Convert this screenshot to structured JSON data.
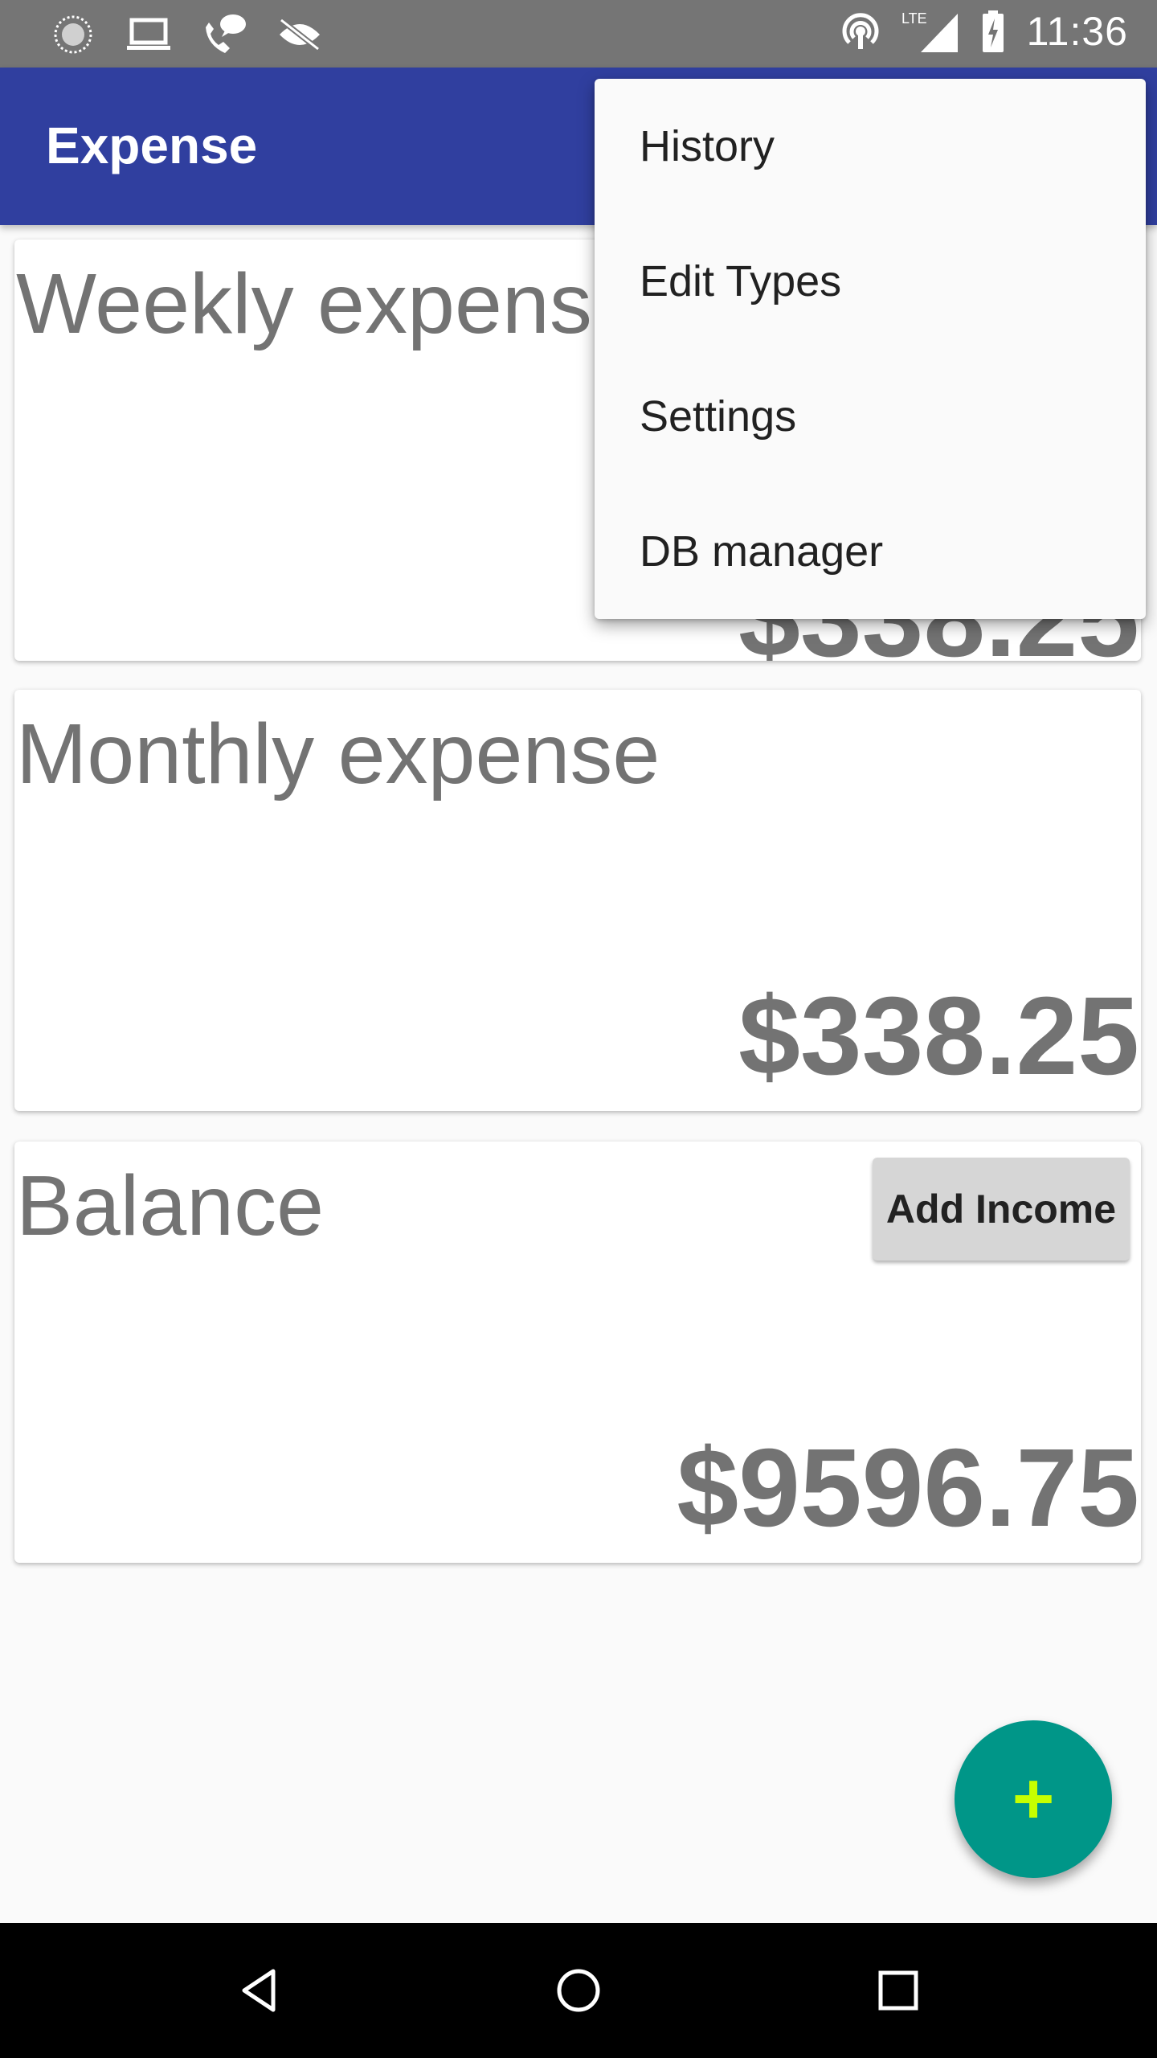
{
  "status_bar": {
    "time": "11:36",
    "network": "LTE",
    "left_icons": [
      "sync-icon",
      "laptop-icon",
      "phone-chat-icon",
      "eye-off-icon"
    ],
    "right_icons": [
      "hotspot-icon",
      "signal-icon",
      "battery-charging-icon"
    ]
  },
  "app_bar": {
    "title": "Expense"
  },
  "menu": {
    "items": [
      {
        "label": "History"
      },
      {
        "label": "Edit Types"
      },
      {
        "label": "Settings"
      },
      {
        "label": "DB manager"
      }
    ]
  },
  "cards": {
    "weekly": {
      "title": "Weekly expense",
      "amount": "$338.25"
    },
    "monthly": {
      "title": "Monthly expense",
      "amount": "$338.25"
    },
    "balance": {
      "title": "Balance",
      "amount": "$9596.75",
      "button_label": "Add Income"
    }
  },
  "fab": {
    "icon": "plus-icon",
    "glyph": "+",
    "color": "#009688",
    "icon_color": "#c6ff00"
  },
  "nav_bar": {
    "buttons": [
      "back-icon",
      "home-icon",
      "recents-icon"
    ]
  },
  "colors": {
    "app_bar": "#303f9f",
    "status_bar": "#757575",
    "text_muted": "#737373"
  }
}
